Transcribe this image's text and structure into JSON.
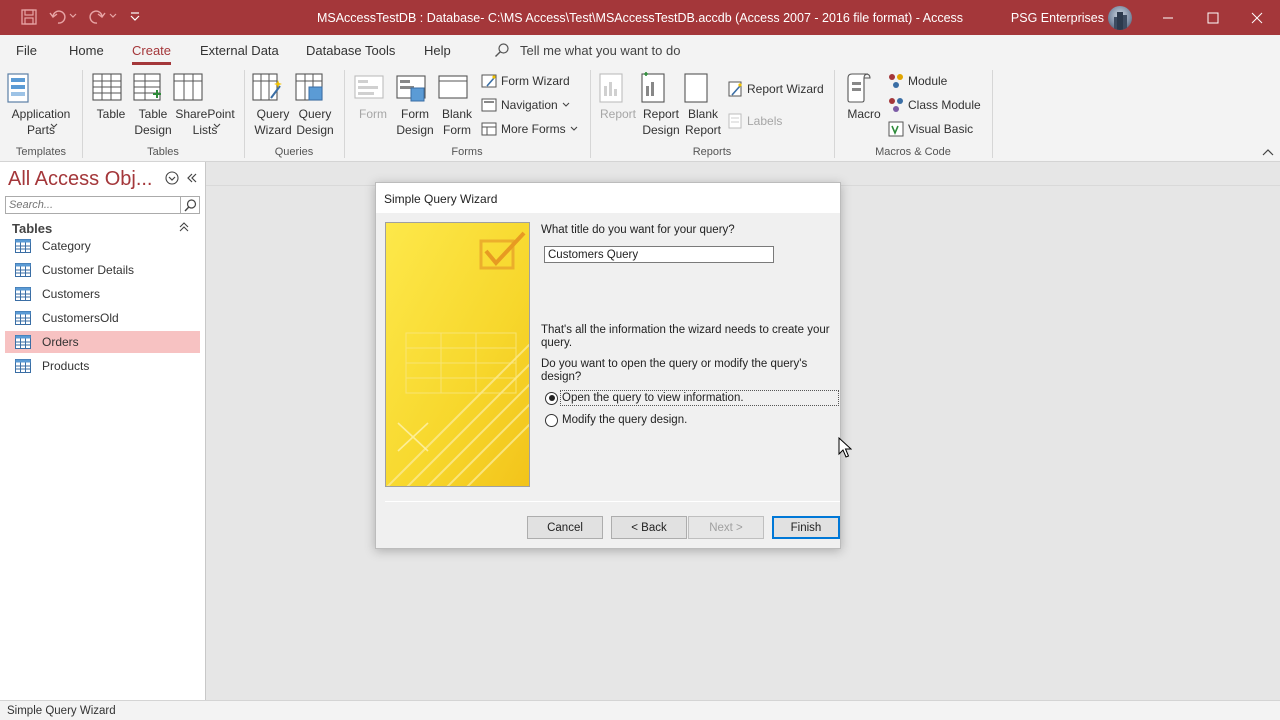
{
  "window": {
    "title": "MSAccessTestDB : Database- C:\\MS Access\\Test\\MSAccessTestDB.accdb (Access 2007 - 2016 file format)  -  Access",
    "user": "PSG Enterprises",
    "accent_color": "#a4373a"
  },
  "menu": {
    "tabs": [
      "File",
      "Home",
      "Create",
      "External Data",
      "Database Tools",
      "Help"
    ],
    "active": "Create",
    "tell_me": "Tell me what you want to do"
  },
  "ribbon": {
    "templates": {
      "label": "Templates",
      "application_parts": "Application Parts"
    },
    "tables": {
      "label": "Tables",
      "table": "Table",
      "table_design": "Table Design",
      "sharepoint_lists": "SharePoint Lists"
    },
    "queries": {
      "label": "Queries",
      "query_wizard": "Query Wizard",
      "query_design": "Query Design"
    },
    "forms": {
      "label": "Forms",
      "form": "Form",
      "form_design": "Form Design",
      "blank_form": "Blank Form",
      "form_wizard": "Form Wizard",
      "navigation": "Navigation",
      "more_forms": "More Forms"
    },
    "reports": {
      "label": "Reports",
      "report": "Report",
      "report_design": "Report Design",
      "blank_report": "Blank Report",
      "report_wizard": "Report Wizard",
      "labels": "Labels"
    },
    "macros": {
      "label": "Macros & Code",
      "macro": "Macro",
      "module": "Module",
      "class_module": "Class Module",
      "visual_basic": "Visual Basic"
    }
  },
  "nav": {
    "title": "All Access Obj...",
    "search_placeholder": "Search...",
    "group": "Tables",
    "items": [
      {
        "label": "Category",
        "selected": false
      },
      {
        "label": "Customer Details",
        "selected": false
      },
      {
        "label": "Customers",
        "selected": false
      },
      {
        "label": "CustomersOld",
        "selected": false
      },
      {
        "label": "Orders",
        "selected": true
      },
      {
        "label": "Products",
        "selected": false
      }
    ]
  },
  "dialog": {
    "title": "Simple Query Wizard",
    "question": "What title do you want for your query?",
    "query_title_value": "Customers Query",
    "info_line1": "That's all the information the wizard needs to create your",
    "info_line2": "query.",
    "question2": "Do you want to open the query or modify the query's design?",
    "options": [
      {
        "label": "Open the query to view information.",
        "checked": true
      },
      {
        "label": "Modify the query design.",
        "checked": false
      }
    ],
    "buttons": {
      "cancel": "Cancel",
      "back": "< Back",
      "next": "Next >",
      "finish": "Finish"
    }
  },
  "status": {
    "text": "Simple Query Wizard"
  }
}
